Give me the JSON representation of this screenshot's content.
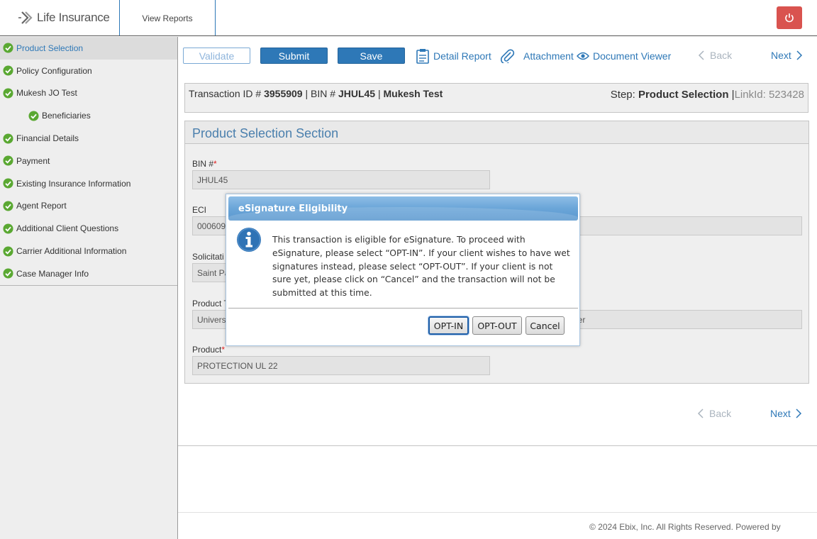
{
  "header": {
    "app_title": "Life Insurance",
    "nav_tab": "View Reports",
    "power_color": "#d9534f"
  },
  "sidebar": {
    "items": [
      {
        "label": "Product Selection",
        "active": true
      },
      {
        "label": "Policy Configuration"
      },
      {
        "label": "Mukesh JO Test"
      },
      {
        "label": "Beneficiaries",
        "sub": true
      },
      {
        "label": "Financial Details"
      },
      {
        "label": "Payment"
      },
      {
        "label": "Existing Insurance Information"
      },
      {
        "label": "Agent Report"
      },
      {
        "label": "Additional Client Questions"
      },
      {
        "label": "Carrier Additional Information"
      },
      {
        "label": "Case Manager Info"
      }
    ]
  },
  "toolbar": {
    "validate": "Validate",
    "submit": "Submit",
    "save": "Save",
    "detail_report": "Detail Report",
    "attachment": "Attachment",
    "document_viewer": "Document Viewer",
    "back": "Back",
    "next": "Next"
  },
  "transaction": {
    "tx_label": "Transaction ID #",
    "tx_id": "3955909",
    "bin_label": "BIN #",
    "bin": "JHUL45",
    "client": "Mukesh Test",
    "step_label": "Step:",
    "step": "Product Selection",
    "link_label": "LinkId: 523428"
  },
  "section": {
    "title": "Product Selection Section",
    "bin_label": "BIN #",
    "bin_value": "JHUL45",
    "eci_label": "ECI",
    "eci_value": "000609",
    "solicit_label": "Solicitati",
    "solicit_value": "Saint Pa",
    "ptype_label": "Product T",
    "ptype_value": "Univers",
    "carrier_value": "rier",
    "product_label": "Product",
    "product_value": "PROTECTION UL 22"
  },
  "bottom_nav": {
    "back": "Back",
    "next": "Next"
  },
  "footer": {
    "copyright": "© 2024 Ebix, Inc. All Rights Reserved. Powered by"
  },
  "modal": {
    "title": "eSignature Eligibility",
    "message": "This transaction is eligible for eSignature. To proceed with eSignature, please select “OPT-IN”. If your client wishes to have wet signatures instead, please select “OPT-OUT”. If your client is not sure yet, please click on “Cancel” and the transaction will not be submitted at this time.",
    "opt_in": "OPT-IN",
    "opt_out": "OPT-OUT",
    "cancel": "Cancel"
  },
  "colors": {
    "accent": "#2e78b7",
    "check": "#5aa832"
  }
}
